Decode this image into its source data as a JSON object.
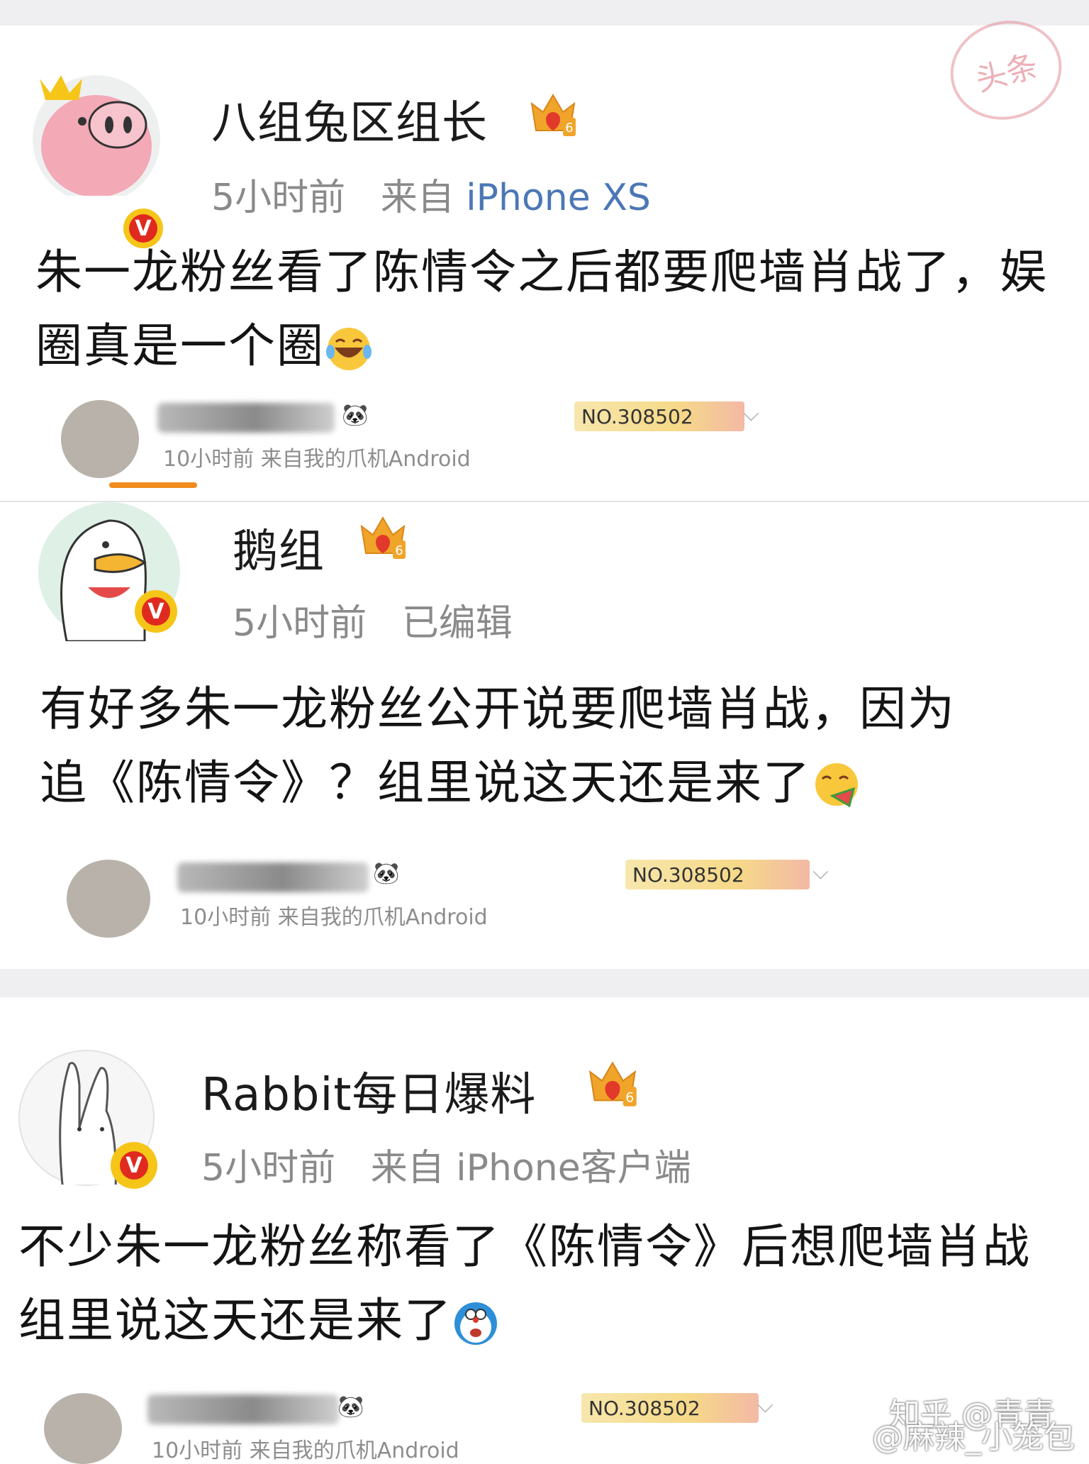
{
  "posts": [
    {
      "username": "八组兔区组长",
      "level": "6",
      "time": "5小时前",
      "from_label": "来自",
      "source": "iPhone XS",
      "content_line1": "朱一龙粉丝看了陈情令之后都要爬墙肖战了，娱",
      "content_line2": "圈真是一个圈",
      "emoji": "laugh-cry-emoji",
      "repost": {
        "meta": "10小时前  来自我的爪机Android",
        "badge": "NO.308502"
      }
    },
    {
      "username": "鹅组",
      "level": "6",
      "time": "5小时前",
      "edited": "已编辑",
      "content_line1": "有好多朱一龙粉丝公开说要爬墙肖战，因为",
      "content_line2": "追《陈情令》？组里说这天还是来了",
      "emoji": "eating-watermelon-emoji",
      "repost": {
        "meta": "10小时前  来自我的爪机Android",
        "badge": "NO.308502"
      }
    },
    {
      "username": "Rabbit每日爆料",
      "level": "6",
      "time": "5小时前",
      "from_label": "来自",
      "source": "iPhone客户端",
      "content_line1": "不少朱一龙粉丝称看了《陈情令》后想爬墙肖战",
      "content_line2": "组里说这天还是来了",
      "emoji": "doraemon-emoji",
      "repost": {
        "meta": "10小时前  来自我的爪机Android",
        "badge": "NO.308502"
      }
    }
  ],
  "stamp_text": "头条",
  "watermark_zhihu": "知乎 @青青",
  "watermark_weibo": "@麻辣_小笼包",
  "colors": {
    "source_link": "#4b77b5",
    "verified_red": "#e02a1f",
    "verified_gold": "#f5c518",
    "band_gray": "#efeff2"
  }
}
